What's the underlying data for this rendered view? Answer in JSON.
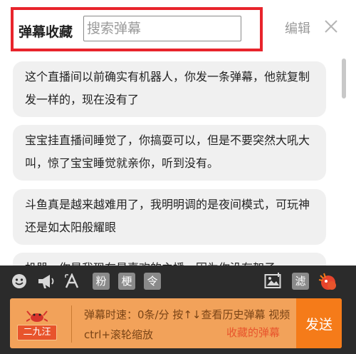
{
  "header": {
    "title": "弹幕收藏",
    "search_placeholder": "搜索弹幕",
    "edit_label": "编辑",
    "close_icon": "close-icon"
  },
  "danmaku_list": [
    "这个直播间以前确实有机器人，你发一条弹幕，他就复制发一样的，现在没有了",
    "宝宝挂直播间睡觉了，你搞耍可以，但是不要突然大吼大叫，惊了宝宝睡觉就亲你，听到没有。",
    "斗鱼真是越来越难用了，我明明调的是夜间模式，可玩神还是如太阳般耀眼",
    "机器，你是我现在最喜欢的主播，因为你没有架子"
  ],
  "toolbar": {
    "fan_label": "粉",
    "meme_label": "梗",
    "command_label": "令",
    "filter_label": "滤"
  },
  "input_bar": {
    "badge": "二九汪",
    "hint": "弹幕时速：0条/分 按↑↓查看历史弹幕 视频ctrl+滚轮缩放",
    "favorites_link": "收藏的弹幕",
    "send_label": "发送"
  },
  "colors": {
    "highlight": "#e8242c",
    "send_button": "#f57b19",
    "input_bar": "#f2a25a",
    "favorites_link": "#e8542c"
  }
}
